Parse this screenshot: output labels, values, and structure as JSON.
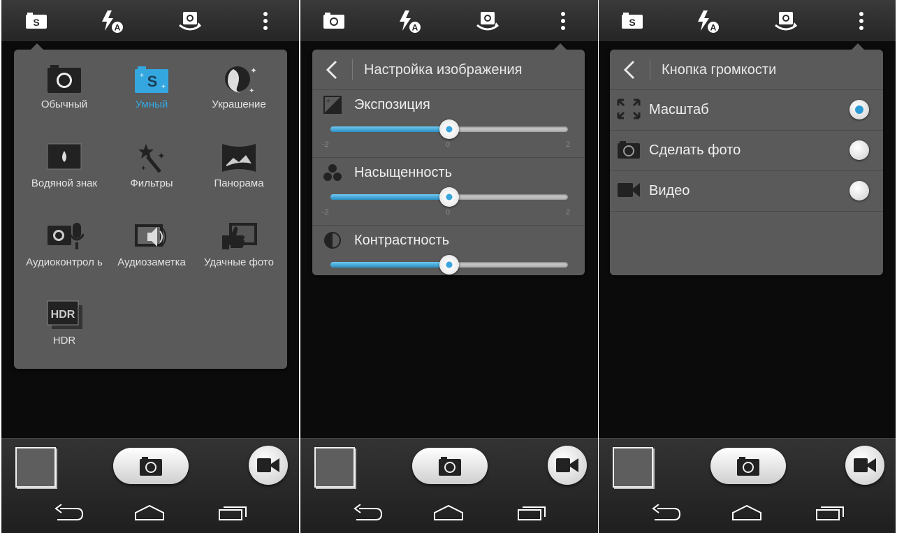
{
  "topbar": {
    "icons": [
      "smart-mode-icon",
      "flash-auto-icon",
      "switch-camera-icon",
      "more-options-icon"
    ],
    "alt_mode_icon": "camera-icon"
  },
  "screen1": {
    "modes": [
      {
        "label": "Обычный",
        "icon": "camera-icon",
        "active": false
      },
      {
        "label": "Умный",
        "icon": "smart-mode-icon",
        "active": true
      },
      {
        "label": "Украшение",
        "icon": "beauty-icon",
        "active": false
      },
      {
        "label": "Водяной знак",
        "icon": "watermark-icon",
        "active": false
      },
      {
        "label": "Фильтры",
        "icon": "filters-icon",
        "active": false
      },
      {
        "label": "Панорама",
        "icon": "panorama-icon",
        "active": false
      },
      {
        "label": "Аудиоконтрол ь",
        "icon": "audio-control-icon",
        "active": false
      },
      {
        "label": "Аудиозаметка",
        "icon": "audio-note-icon",
        "active": false
      },
      {
        "label": "Удачные фото",
        "icon": "good-photos-icon",
        "active": false
      },
      {
        "label": "HDR",
        "icon": "hdr-icon",
        "active": false
      }
    ],
    "accent_color": "#35a7e0"
  },
  "screen2": {
    "title": "Настройка изображения",
    "settings": [
      {
        "label": "Экспозиция",
        "icon": "exposure-icon",
        "value": 0,
        "min": -2,
        "max": 2,
        "tick_min": "-2",
        "tick_mid": "0",
        "tick_max": "2"
      },
      {
        "label": "Насыщенность",
        "icon": "saturation-icon",
        "value": 0,
        "min": -2,
        "max": 2,
        "tick_min": "-2",
        "tick_mid": "0",
        "tick_max": "2"
      },
      {
        "label": "Контрастность",
        "icon": "contrast-icon",
        "value": 0,
        "min": -2,
        "max": 2
      }
    ]
  },
  "screen3": {
    "title": "Кнопка громкости",
    "options": [
      {
        "label": "Масштаб",
        "icon": "zoom-icon",
        "selected": true
      },
      {
        "label": "Сделать фото",
        "icon": "camera-icon",
        "selected": false
      },
      {
        "label": "Видео",
        "icon": "video-icon",
        "selected": false
      }
    ]
  },
  "bottom": {
    "controls": [
      "gallery-thumbnail",
      "shutter-button",
      "video-record-button"
    ],
    "nav": [
      "back-icon",
      "home-icon",
      "recent-apps-icon"
    ]
  }
}
